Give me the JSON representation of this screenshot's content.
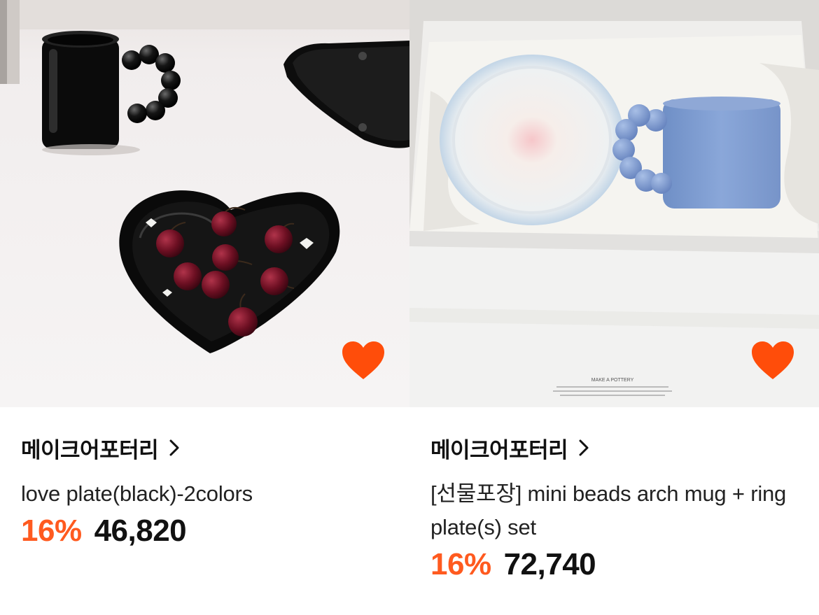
{
  "products": [
    {
      "brand": "메이크어포터리",
      "title": "love plate(black)-2colors",
      "discount": "16%",
      "price": "46,820",
      "image": "black heart plate with cherries, black beaded-handle mug and black plate on white table",
      "liked": true
    },
    {
      "brand": "메이크어포터리",
      "title": "[선물포장] mini beads arch mug + ring plate(s) set",
      "discount": "16%",
      "price": "72,740",
      "image": "blue gradient ring plate and blue beaded-handle mug in white gift box",
      "box_print": "MAKE A POTTERY",
      "liked": true
    }
  ],
  "colors": {
    "accent": "#ff5a1f",
    "heart": "#ff4d0a"
  },
  "icons": {
    "like": "heart-icon",
    "brand_link": "chevron-right-icon"
  }
}
